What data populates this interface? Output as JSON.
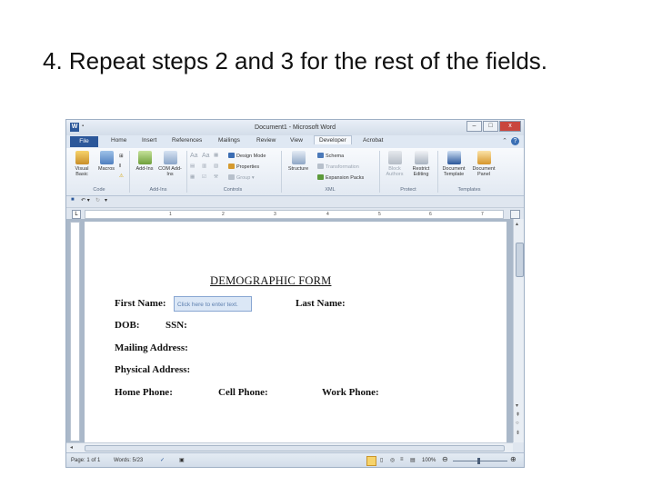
{
  "slide": {
    "heading": "4. Repeat steps 2 and 3 for the rest of the fields."
  },
  "window": {
    "title": "Document1 - Microsoft Word",
    "app_icon": "W",
    "buttons": [
      "–",
      "□",
      "x"
    ]
  },
  "tabs": [
    "File",
    "Home",
    "Insert",
    "References",
    "Mailings",
    "Review",
    "View",
    "Developer",
    "Acrobat"
  ],
  "active_tab": "Developer",
  "ribbon": {
    "code": {
      "label": "Code",
      "visual_basic": "Visual Basic",
      "macros": "Macros"
    },
    "addins": {
      "label": "Add-Ins",
      "addins": "Add-Ins",
      "com": "COM Add-Ins"
    },
    "controls": {
      "label": "Controls",
      "aa1": "Aa",
      "aa2": "Aa",
      "design_mode": "Design Mode",
      "properties": "Properties",
      "group": "Group"
    },
    "xml": {
      "label": "XML",
      "structure": "Structure",
      "schema": "Schema",
      "transformation": "Transformation",
      "expansion_packs": "Expansion Packs"
    },
    "protect": {
      "label": "Protect",
      "block_authors": "Block Authors",
      "restrict_editing": "Restrict Editing"
    },
    "templates": {
      "label": "Templates",
      "document_template": "Document Template",
      "document_panel": "Document Panel"
    }
  },
  "ruler": {
    "numbers": [
      "1",
      "2",
      "3",
      "4",
      "5",
      "6",
      "7"
    ]
  },
  "document": {
    "form_title": "DEMOGRAPHIC FORM",
    "content_control_placeholder": "Click here to enter text.",
    "fields": {
      "first_name": "First Name:",
      "last_name": "Last Name:",
      "dob": "DOB:",
      "ssn": "SSN:",
      "mailing_address": "Mailing  Address:",
      "physical_address": "Physical Address:",
      "home_phone": "Home Phone:",
      "cell_phone": "Cell Phone:",
      "work_phone": "Work  Phone:"
    }
  },
  "status": {
    "page": "Page: 1 of 1",
    "words": "Words: 5/23",
    "zoom": "100%"
  }
}
